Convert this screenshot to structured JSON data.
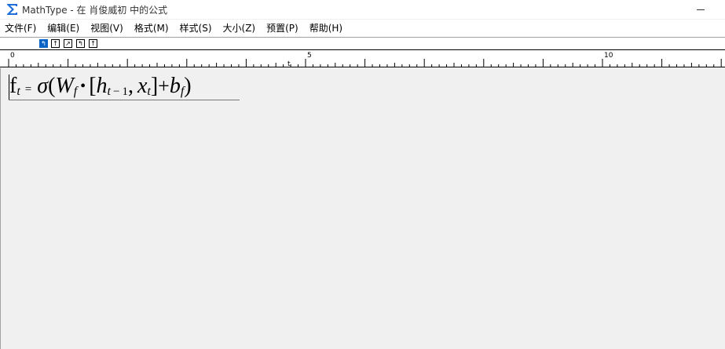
{
  "window": {
    "title": "MathType - 在 肖俊威初 中的公式",
    "icon": "sigma-icon"
  },
  "menu": [
    {
      "label": "文件(F)"
    },
    {
      "label": "编辑(E)"
    },
    {
      "label": "视图(V)"
    },
    {
      "label": "格式(M)"
    },
    {
      "label": "样式(S)"
    },
    {
      "label": "大小(Z)"
    },
    {
      "label": "预置(P)"
    },
    {
      "label": "帮助(H)"
    }
  ],
  "tab_buttons": [
    {
      "label": "↰",
      "active": true
    },
    {
      "label": "↑",
      "active": false
    },
    {
      "label": "↗",
      "active": false
    },
    {
      "label": "↰",
      "active": false
    },
    {
      "label": "↑",
      "active": false
    }
  ],
  "ruler": {
    "labels": [
      "0",
      "5",
      "10"
    ],
    "tab_marker": "t"
  },
  "equation": {
    "f": "f",
    "t1": "t",
    "eq": "=",
    "sigma": "σ",
    "lparen": "(",
    "W": "W",
    "sub_f1": "f",
    "bullet": "•",
    "lbracket": "[",
    "h": "h",
    "t2": "t",
    "minus": "−",
    "one": "1",
    "comma": ",",
    "x": "x",
    "t3": "t",
    "rbracket": "]",
    "plus": "+",
    "b": "b",
    "sub_f2": "f",
    "rparen": ")"
  }
}
